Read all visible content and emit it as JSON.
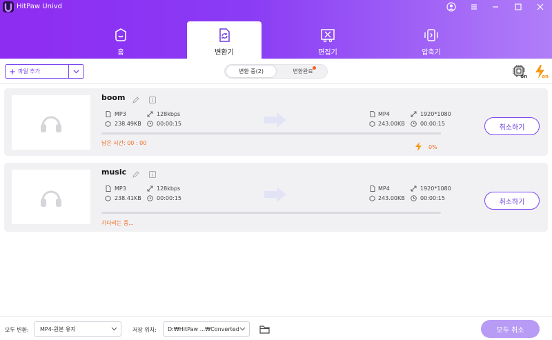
{
  "app": {
    "title": "HitPaw Univd"
  },
  "tabs": [
    {
      "label": "홈",
      "icon": "home-icon"
    },
    {
      "label": "변환기",
      "icon": "converter-icon",
      "active": true
    },
    {
      "label": "편집기",
      "icon": "editor-icon"
    },
    {
      "label": "압축기",
      "icon": "compressor-icon"
    }
  ],
  "toolbar": {
    "add_file_label": "파일 추가",
    "segment_converting": "변환 중(2)",
    "segment_converted": "변환완료",
    "gpu_icon": "gpu-accel-on-icon",
    "turbo_icon": "turbo-on-icon",
    "turbo_badge": "on",
    "gpu_badge": "on"
  },
  "files": [
    {
      "name": "boom",
      "source": {
        "format": "MP3",
        "size": "238.49KB",
        "bitrate": "128kbps",
        "duration": "00:00:15"
      },
      "target": {
        "format": "MP4",
        "size": "243.00KB",
        "resolution": "1920*1080",
        "duration": "00:00:15"
      },
      "status": "남은 시간: 00 : 00",
      "progress_percent": "0%",
      "progress_value": 0,
      "cancel_label": "취소하기"
    },
    {
      "name": "music",
      "source": {
        "format": "MP3",
        "size": "238.41KB",
        "bitrate": "128kbps",
        "duration": "00:00:15"
      },
      "target": {
        "format": "MP4",
        "size": "243.00KB",
        "resolution": "1920*1080",
        "duration": "00:00:15"
      },
      "status": "기다리는 중...",
      "progress_value": 0,
      "cancel_label": "취소하기"
    }
  ],
  "footer": {
    "convert_all_label": "모두 변환:",
    "convert_all_value": "MP4-원본 유지",
    "save_location_label": "저장 위치:",
    "save_location_value": "D:₩HitPaw ...₩Converted",
    "cancel_all_label": "모두 취소"
  },
  "colors": {
    "accent": "#7b45f0",
    "header_start": "#8e2cf2",
    "header_end": "#b07ef8",
    "status": "#ef6a1b"
  }
}
